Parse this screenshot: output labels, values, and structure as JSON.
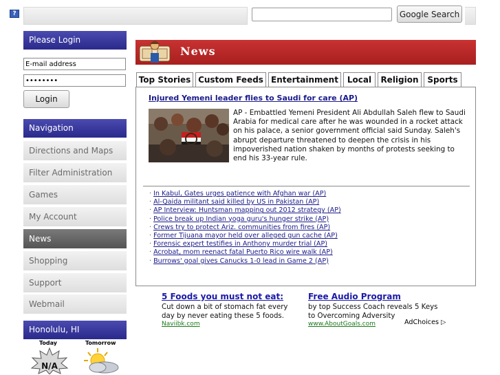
{
  "topbar": {
    "help_icon": "?",
    "search_value": "",
    "search_button": "Google Search"
  },
  "login": {
    "header": "Please Login",
    "email_value": "E-mail address",
    "password_value": "••••••••",
    "button": "Login"
  },
  "navigation": {
    "header": "Navigation",
    "items": [
      {
        "label": "Directions and Maps",
        "active": false
      },
      {
        "label": "Filter Administration",
        "active": false
      },
      {
        "label": "Games",
        "active": false
      },
      {
        "label": "My Account",
        "active": false
      },
      {
        "label": "News",
        "active": true
      },
      {
        "label": "Shopping",
        "active": false
      },
      {
        "label": "Support",
        "active": false
      },
      {
        "label": "Webmail",
        "active": false
      }
    ]
  },
  "weather": {
    "location": "Honolulu, HI",
    "today_label": "Today",
    "tomorrow_label": "Tomorrow",
    "today_value": "N/A",
    "today_icon": "na-burst-icon",
    "tomorrow_icon": "sun-cloud-icon"
  },
  "news": {
    "title": "News",
    "banner_icon": "newsreader-icon",
    "tabs": [
      {
        "label": "Top Stories",
        "active": true
      },
      {
        "label": "Custom Feeds",
        "active": false
      },
      {
        "label": "Entertainment",
        "active": false
      },
      {
        "label": "Local",
        "active": false
      },
      {
        "label": "Religion",
        "active": false
      },
      {
        "label": "Sports",
        "active": false
      }
    ],
    "top_story": {
      "headline": "Injured Yemeni leader flies to Saudi for care (AP)",
      "body": "AP - Embattled Yemeni President Ali Abdullah Saleh flew to Saudi Arabia for medical care after he was wounded in a rocket attack on his palace, a senior government official said Sunday. Saleh's abrupt departure threatened to deepen the crisis in his impoverished nation shaken by months of protests seeking to end his 33-year rule."
    },
    "related": [
      "In Kabul, Gates urges patience with Afghan war (AP)",
      "Al-Qaida militant said killed by US in Pakistan (AP)",
      "AP Interview: Huntsman mapping out 2012 strategy (AP)",
      "Police break up Indian yoga guru's hunger strike (AP)",
      "Crews try to protect Ariz. communities from fires (AP)",
      "Former Tijuana mayor held over alleged gun cache (AP)",
      "Forensic expert testifies in Anthony murder trial (AP)",
      "Acrobat, mom reenact fatal Puerto Rico wire walk (AP)",
      "Burrows' goal gives Canucks 1-0 lead in Game 2 (AP)"
    ]
  },
  "ads": [
    {
      "title": "5 Foods you must not eat:",
      "desc": "Cut down a bit of stomach fat every day by never eating these 5 foods.",
      "url": "Naviibk.com"
    },
    {
      "title": "Free Audio Program",
      "desc": "by top Success Coach reveals 5 Keys to Overcoming Adversity",
      "url": "www.AboutGoals.com"
    }
  ],
  "adchoices": "AdChoices ▷",
  "colors": {
    "brand_blue": "#2a2a8c",
    "news_red": "#b52626",
    "link_blue": "#1a1a8a"
  }
}
